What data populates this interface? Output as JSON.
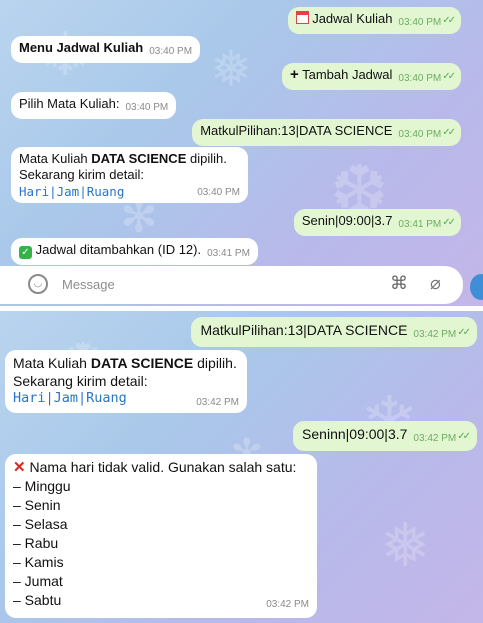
{
  "colors": {
    "bubble_out": "#e3f6d2",
    "bubble_in": "#ffffff",
    "link": "#2b74c8",
    "tick": "#4fae4e"
  },
  "panel1": {
    "messages": [
      {
        "dir": "out",
        "icon": "calendar-icon",
        "text": "Jadwal Kuliah",
        "time": "03:40 PM"
      },
      {
        "dir": "in",
        "bold": "Menu Jadwal Kuliah",
        "time": "03:40 PM"
      },
      {
        "dir": "out",
        "icon": "plus-icon",
        "text": "Tambah Jadwal",
        "time": "03:40 PM"
      },
      {
        "dir": "in",
        "text": "Pilih Mata Kuliah:",
        "time": "03:40 PM"
      },
      {
        "dir": "out",
        "text": "MatkulPilihan:13|DATA SCIENCE",
        "time": "03:40 PM"
      },
      {
        "dir": "in",
        "pre": "Mata Kuliah ",
        "bold": "DATA SCIENCE",
        "post": " dipilih.",
        "line2": "Sekarang kirim detail:",
        "code": "Hari|Jam|Ruang",
        "time": "03:40 PM"
      },
      {
        "dir": "out",
        "text": "Senin|09:00|3.7",
        "time": "03:41 PM"
      },
      {
        "dir": "in",
        "icon": "check-icon",
        "text": "Jadwal ditambahkan (ID 12).",
        "time": "03:41 PM"
      }
    ],
    "input": {
      "placeholder": "Message"
    }
  },
  "panel2": {
    "messages": [
      {
        "dir": "out",
        "text": "MatkulPilihan:13|DATA SCIENCE",
        "time": "03:42 PM"
      },
      {
        "dir": "in",
        "pre": "Mata Kuliah ",
        "bold": "DATA SCIENCE",
        "post": " dipilih.",
        "line2": "Sekarang kirim detail:",
        "code": "Hari|Jam|Ruang",
        "time": "03:42 PM"
      },
      {
        "dir": "out",
        "text": "Seninn|09:00|3.7",
        "time": "03:42 PM"
      },
      {
        "dir": "in",
        "icon": "cross-icon",
        "text": "Nama hari tidak valid. Gunakan salah satu:",
        "items": [
          "– Minggu",
          "– Senin",
          "– Selasa",
          "– Rabu",
          "– Kamis",
          "– Jumat",
          "– Sabtu"
        ],
        "time": "03:42 PM"
      }
    ]
  }
}
